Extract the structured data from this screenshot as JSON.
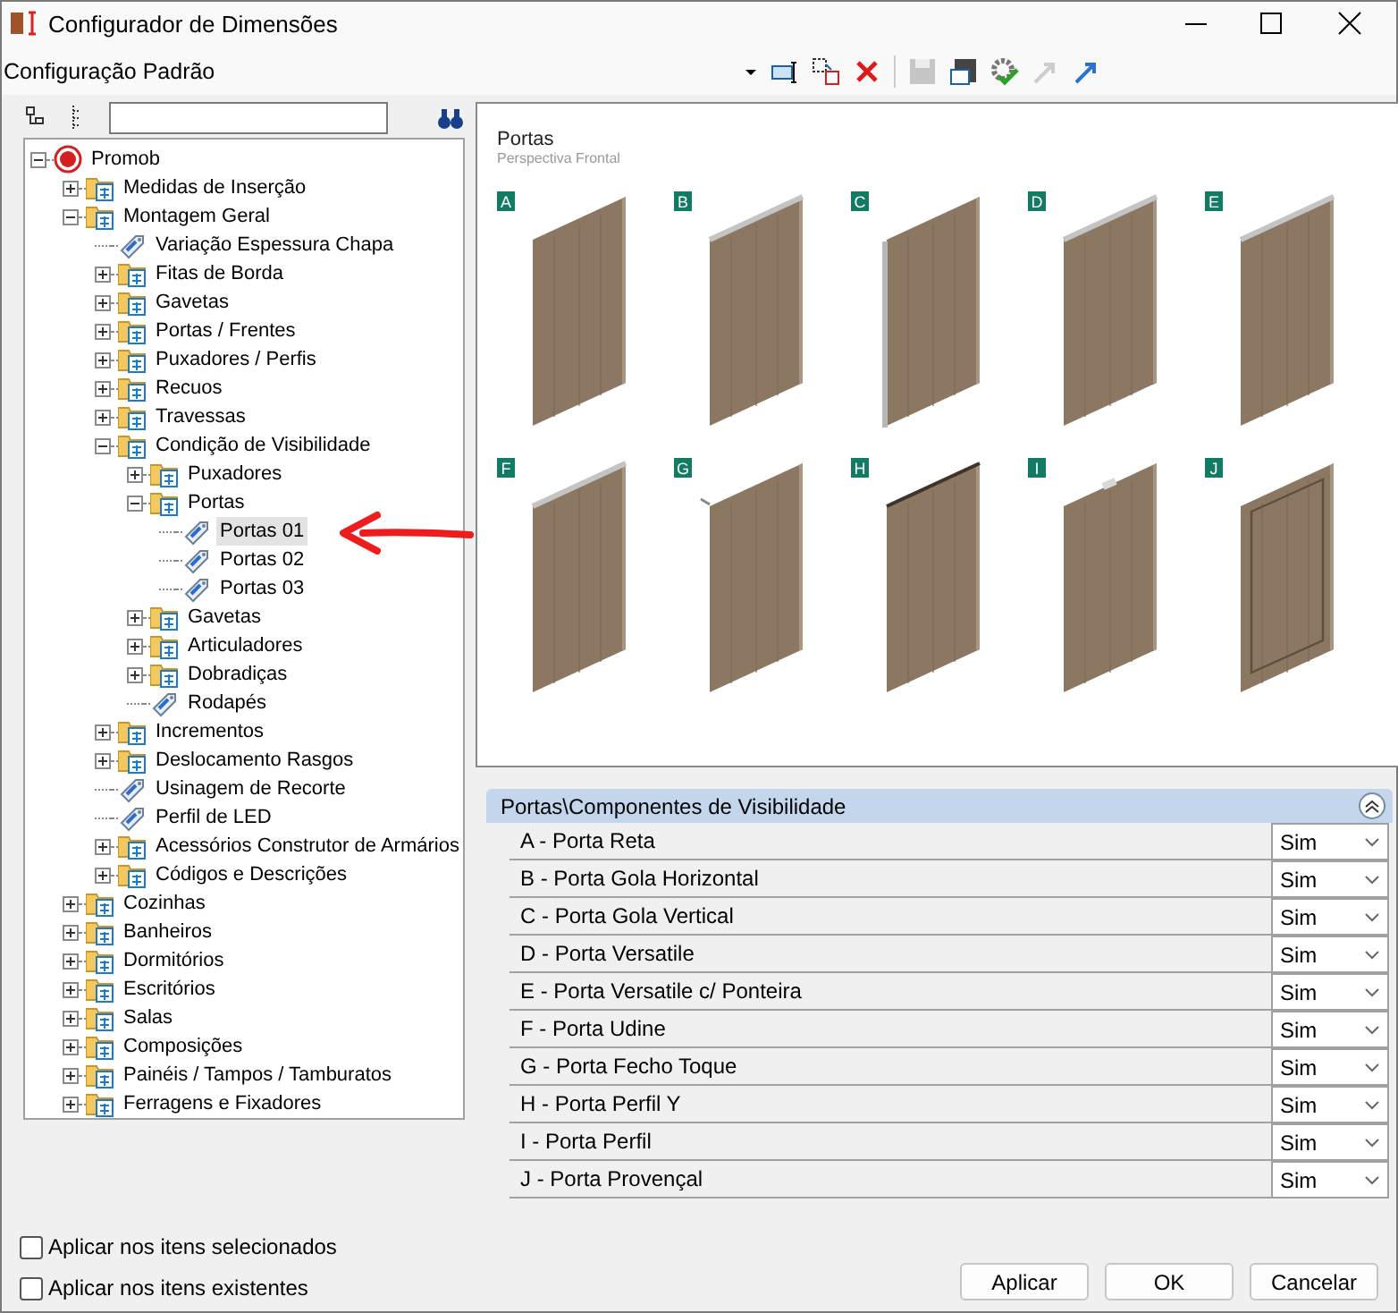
{
  "window": {
    "title": "Configurador de Dimensões"
  },
  "configuration": {
    "value": "Configuração Padrão"
  },
  "tree": [
    {
      "label": "Promob",
      "kind": "root",
      "expanded": true,
      "selected": false,
      "children": [
        {
          "label": "Medidas de Inserção",
          "kind": "folder",
          "expanded": false,
          "selected": false
        },
        {
          "label": "Montagem Geral",
          "kind": "folder",
          "expanded": true,
          "selected": false,
          "children": [
            {
              "label": "Variação Espessura Chapa",
              "kind": "item",
              "selected": false
            },
            {
              "label": "Fitas de Borda",
              "kind": "folder",
              "expanded": false,
              "selected": false
            },
            {
              "label": "Gavetas",
              "kind": "folder",
              "expanded": false,
              "selected": false
            },
            {
              "label": "Portas / Frentes",
              "kind": "folder",
              "expanded": false,
              "selected": false
            },
            {
              "label": "Puxadores / Perfis",
              "kind": "folder",
              "expanded": false,
              "selected": false
            },
            {
              "label": "Recuos",
              "kind": "folder",
              "expanded": false,
              "selected": false
            },
            {
              "label": "Travessas",
              "kind": "folder",
              "expanded": false,
              "selected": false
            },
            {
              "label": "Condição de Visibilidade",
              "kind": "folder",
              "expanded": true,
              "selected": false,
              "children": [
                {
                  "label": "Puxadores",
                  "kind": "folder",
                  "expanded": false,
                  "selected": false
                },
                {
                  "label": "Portas",
                  "kind": "folder",
                  "expanded": true,
                  "selected": false,
                  "children": [
                    {
                      "label": "Portas 01",
                      "kind": "item",
                      "selected": true
                    },
                    {
                      "label": "Portas 02",
                      "kind": "item",
                      "selected": false
                    },
                    {
                      "label": "Portas 03",
                      "kind": "item",
                      "selected": false
                    }
                  ]
                },
                {
                  "label": "Gavetas",
                  "kind": "folder",
                  "expanded": false,
                  "selected": false
                },
                {
                  "label": "Articuladores",
                  "kind": "folder",
                  "expanded": false,
                  "selected": false
                },
                {
                  "label": "Dobradiças",
                  "kind": "folder",
                  "expanded": false,
                  "selected": false
                },
                {
                  "label": "Rodapés",
                  "kind": "item",
                  "selected": false
                }
              ]
            },
            {
              "label": "Incrementos",
              "kind": "folder",
              "expanded": false,
              "selected": false
            },
            {
              "label": "Deslocamento Rasgos",
              "kind": "folder",
              "expanded": false,
              "selected": false
            },
            {
              "label": "Usinagem de Recorte",
              "kind": "item",
              "selected": false
            },
            {
              "label": "Perfil de LED",
              "kind": "item",
              "selected": false
            },
            {
              "label": "Acessórios Construtor de Armários",
              "kind": "folder",
              "expanded": false,
              "selected": false
            },
            {
              "label": "Códigos e Descrições",
              "kind": "folder",
              "expanded": false,
              "selected": false
            }
          ]
        },
        {
          "label": "Cozinhas",
          "kind": "folder",
          "expanded": false,
          "selected": false
        },
        {
          "label": "Banheiros",
          "kind": "folder",
          "expanded": false,
          "selected": false
        },
        {
          "label": "Dormitórios",
          "kind": "folder",
          "expanded": false,
          "selected": false
        },
        {
          "label": "Escritórios",
          "kind": "folder",
          "expanded": false,
          "selected": false
        },
        {
          "label": "Salas",
          "kind": "folder",
          "expanded": false,
          "selected": false
        },
        {
          "label": "Composições",
          "kind": "folder",
          "expanded": false,
          "selected": false
        },
        {
          "label": "Painéis / Tampos / Tamburatos",
          "kind": "folder",
          "expanded": false,
          "selected": false
        },
        {
          "label": "Ferragens e Fixadores",
          "kind": "folder",
          "expanded": false,
          "selected": false
        }
      ]
    }
  ],
  "preview": {
    "title": "Portas",
    "subtitle": "Perspectiva Frontal",
    "doors": [
      {
        "letter": "A",
        "kind": "plain"
      },
      {
        "letter": "B",
        "kind": "top-profile"
      },
      {
        "letter": "C",
        "kind": "side-profile"
      },
      {
        "letter": "D",
        "kind": "top-profile"
      },
      {
        "letter": "E",
        "kind": "top-profile"
      },
      {
        "letter": "F",
        "kind": "top-profile"
      },
      {
        "letter": "G",
        "kind": "pin"
      },
      {
        "letter": "H",
        "kind": "dark-top"
      },
      {
        "letter": "I",
        "kind": "small-handle"
      },
      {
        "letter": "J",
        "kind": "frame"
      }
    ]
  },
  "properties": {
    "title": "Portas\\Componentes de Visibilidade",
    "expanded": true,
    "rows": [
      {
        "label": "A - Porta Reta",
        "value": "Sim"
      },
      {
        "label": "B - Porta Gola Horizontal",
        "value": "Sim"
      },
      {
        "label": "C - Porta Gola Vertical",
        "value": "Sim"
      },
      {
        "label": "D - Porta Versatile",
        "value": "Sim"
      },
      {
        "label": "E - Porta Versatile c/ Ponteira",
        "value": "Sim"
      },
      {
        "label": "F - Porta Udine",
        "value": "Sim"
      },
      {
        "label": "G - Porta Fecho Toque",
        "value": "Sim"
      },
      {
        "label": "H - Porta Perfil Y",
        "value": "Sim"
      },
      {
        "label": "I - Porta Perfil",
        "value": "Sim"
      },
      {
        "label": "J - Porta Provençal",
        "value": "Sim"
      }
    ]
  },
  "options": [
    {
      "label": "Aplicar nos itens selecionados",
      "checked": false
    },
    {
      "label": "Aplicar nos itens existentes",
      "checked": false
    }
  ],
  "buttons": [
    "Aplicar",
    "OK",
    "Cancelar"
  ]
}
